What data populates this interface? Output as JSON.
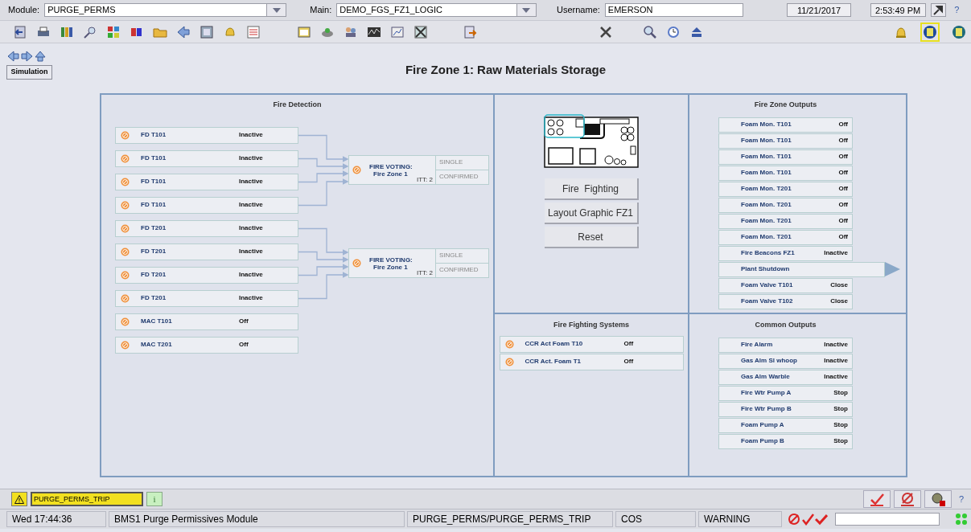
{
  "header": {
    "module": {
      "label": "Module:",
      "value": "PURGE_PERMS"
    },
    "main": {
      "label": "Main:",
      "value": "DEMO_FGS_FZ1_LOGIC"
    },
    "username": {
      "label": "Username:",
      "value": "EMERSON"
    },
    "date": "11/21/2017",
    "time": "2:53:49 PM",
    "help": "?"
  },
  "nav": {
    "simulation": "Simulation"
  },
  "title": "Fire Zone 1: Raw Materials Storage",
  "fire_detection": {
    "title": "Fire Detection",
    "groups": [
      {
        "inputs": [
          {
            "tag": "FD T101",
            "state": "Inactive"
          },
          {
            "tag": "FD T101",
            "state": "Inactive"
          },
          {
            "tag": "FD T101",
            "state": "Inactive"
          },
          {
            "tag": "FD T101",
            "state": "Inactive"
          }
        ],
        "voting": {
          "line1": "FIRE VOTING:",
          "line2": "Fire Zone 1",
          "itt": "ITT: 2",
          "single": "SINGLE",
          "confirmed": "CONFIRMED"
        }
      },
      {
        "inputs": [
          {
            "tag": "FD T201",
            "state": "Inactive"
          },
          {
            "tag": "FD T201",
            "state": "Inactive"
          },
          {
            "tag": "FD T201",
            "state": "Inactive"
          },
          {
            "tag": "FD T201",
            "state": "Inactive"
          }
        ],
        "voting": {
          "line1": "FIRE VOTING:",
          "line2": "Fire Zone 1",
          "itt": "ITT: 2",
          "single": "SINGLE",
          "confirmed": "CONFIRMED"
        }
      }
    ],
    "other_inputs": [
      {
        "tag": "MAC T101",
        "state": "Off"
      },
      {
        "tag": "MAC T201",
        "state": "Off"
      }
    ]
  },
  "navigation_buttons": [
    "Fire  Fighting",
    "Layout Graphic FZ1",
    "Reset"
  ],
  "fire_zone_outputs": {
    "title": "Fire Zone Outputs",
    "items": [
      {
        "kind": "output",
        "label": "Foam Mon. T101",
        "state": "Off"
      },
      {
        "kind": "output",
        "label": "Foam Mon. T101",
        "state": "Off"
      },
      {
        "kind": "output",
        "label": "Foam Mon. T101",
        "state": "Off"
      },
      {
        "kind": "output",
        "label": "Foam Mon. T101",
        "state": "Off"
      },
      {
        "kind": "output",
        "label": "Foam Mon. T201",
        "state": "Off"
      },
      {
        "kind": "output",
        "label": "Foam Mon. T201",
        "state": "Off"
      },
      {
        "kind": "output",
        "label": "Foam Mon. T201",
        "state": "Off"
      },
      {
        "kind": "output",
        "label": "Foam Mon. T201",
        "state": "Off"
      },
      {
        "kind": "output",
        "label": "Fire Beacons FZ1",
        "state": "Inactive"
      },
      {
        "kind": "link",
        "label": "Plant Shutdown"
      },
      {
        "kind": "output",
        "label": "Foam Valve T101",
        "state": "Close"
      },
      {
        "kind": "output",
        "label": "Foam Valve T102",
        "state": "Close"
      }
    ]
  },
  "fire_fighting_systems": {
    "title": "Fire Fighting Systems",
    "items": [
      {
        "tag": "CCR Act Foam T10",
        "state": "Off"
      },
      {
        "tag": "CCR Act. Foam T1",
        "state": "Off"
      }
    ]
  },
  "common_outputs": {
    "title": "Common Outputs",
    "items": [
      {
        "label": "Fire Alarm",
        "state": "Inactive"
      },
      {
        "label": "Gas Alm Sl whoop",
        "state": "Inactive"
      },
      {
        "label": "Gas Alm Warble",
        "state": "Inactive"
      },
      {
        "label": "Fire Wtr Pump A",
        "state": "Stop"
      },
      {
        "label": "Fire Wtr Pump B",
        "state": "Stop"
      },
      {
        "label": "Foam Pump A",
        "state": "Stop"
      },
      {
        "label": "Foam Pump B",
        "state": "Stop"
      }
    ]
  },
  "alarm_bar": {
    "alarm": "PURGE_PERMS_TRIP",
    "info": "i",
    "help": "?"
  },
  "status_bar": {
    "fields": [
      "Wed 17:44:36",
      "BMS1 Purge Permissives Module",
      "PURGE_PERMS/PURGE_PERMS_TRIP",
      "COS",
      "WARNING"
    ]
  }
}
